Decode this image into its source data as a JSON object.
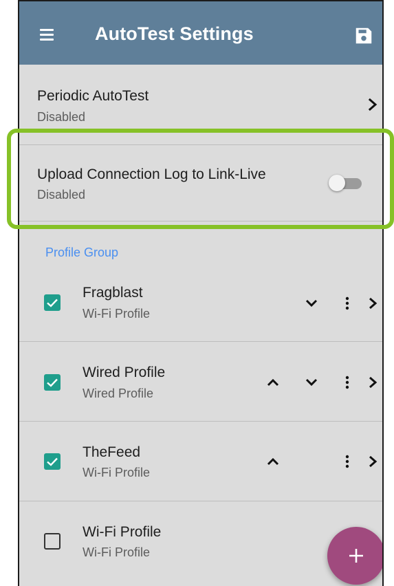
{
  "header": {
    "title": "AutoTest Settings",
    "menu_icon": "menu-icon",
    "save_icon": "save-icon"
  },
  "settings": {
    "periodic": {
      "title": "Periodic AutoTest",
      "value": "Disabled"
    },
    "upload": {
      "title": "Upload Connection Log to Link-Live",
      "value": "Disabled",
      "toggle_on": false
    }
  },
  "profile_group": {
    "header": "Profile Group",
    "items": [
      {
        "name": "Fragblast",
        "type": "Wi-Fi Profile",
        "checked": true,
        "move_up": false,
        "move_down": true
      },
      {
        "name": "Wired Profile",
        "type": "Wired Profile",
        "checked": true,
        "move_up": true,
        "move_down": true
      },
      {
        "name": "TheFeed",
        "type": "Wi-Fi Profile",
        "checked": true,
        "move_up": true,
        "move_down": false
      },
      {
        "name": "Wi-Fi Profile",
        "type": "Wi-Fi Profile",
        "checked": false,
        "move_up": false,
        "move_down": false
      }
    ]
  },
  "fab": {
    "icon": "plus-icon"
  },
  "colors": {
    "app_bar": "#5f7f99",
    "background": "#dcdcdc",
    "accent": "#4a8ff0",
    "checkbox": "#1f9e8c",
    "fab": "#a04a7e",
    "highlight": "#86c127"
  }
}
